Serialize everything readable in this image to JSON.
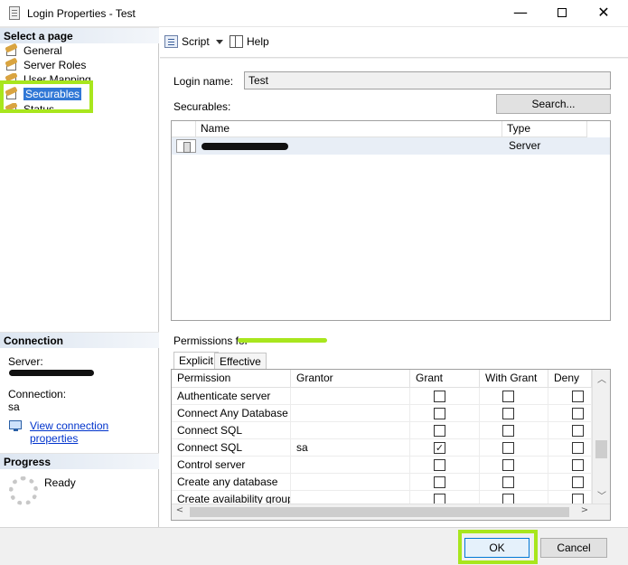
{
  "window": {
    "title": "Login Properties - Test",
    "min_symbol": "—",
    "close_symbol": "✕"
  },
  "left": {
    "select_page_header": "Select a page",
    "pages": [
      {
        "label": "General",
        "icon": "page-wrench-icon"
      },
      {
        "label": "Server Roles",
        "icon": "page-wrench-icon"
      },
      {
        "label": "User Mapping",
        "icon": "page-wrench-icon"
      },
      {
        "label": "Securables",
        "icon": "page-wrench-icon",
        "selected": true
      },
      {
        "label": "Status",
        "icon": "page-wrench-icon"
      }
    ],
    "connection_header": "Connection",
    "server_label": "Server:",
    "connection_label": "Connection:",
    "connection_value": "sa",
    "view_link": "View connection properties",
    "progress_header": "Progress",
    "progress_status": "Ready"
  },
  "toolbar": {
    "script_label": "Script",
    "help_label": "Help"
  },
  "form": {
    "login_name_label": "Login name:",
    "login_name_value": "Test",
    "securables_label": "Securables:",
    "search_button": "Search...",
    "securables_columns": [
      "Name",
      "Type"
    ],
    "securables_rows": [
      {
        "name": "",
        "type": "Server"
      }
    ],
    "permissions_for_label": "Permissions for",
    "tabs": [
      "Explicit",
      "Effective"
    ],
    "permission_columns": [
      "Permission",
      "Grantor",
      "Grant",
      "With Grant",
      "Deny"
    ],
    "permission_rows": [
      {
        "permission": "Authenticate server",
        "grantor": "",
        "grant": false,
        "with_grant": false,
        "deny": false
      },
      {
        "permission": "Connect Any Database",
        "grantor": "",
        "grant": false,
        "with_grant": false,
        "deny": false
      },
      {
        "permission": "Connect SQL",
        "grantor": "",
        "grant": false,
        "with_grant": false,
        "deny": false
      },
      {
        "permission": "Connect SQL",
        "grantor": "sa",
        "grant": true,
        "with_grant": false,
        "deny": false
      },
      {
        "permission": "Control server",
        "grantor": "",
        "grant": false,
        "with_grant": false,
        "deny": false
      },
      {
        "permission": "Create any database",
        "grantor": "",
        "grant": false,
        "with_grant": false,
        "deny": false
      },
      {
        "permission": "Create availability group",
        "grantor": "",
        "grant": false,
        "with_grant": false,
        "deny": false
      }
    ]
  },
  "buttons": {
    "ok": "OK",
    "cancel": "Cancel"
  },
  "colors": {
    "highlight": "#a8e61d",
    "selected": "#3178d6",
    "link": "#0033cc"
  }
}
